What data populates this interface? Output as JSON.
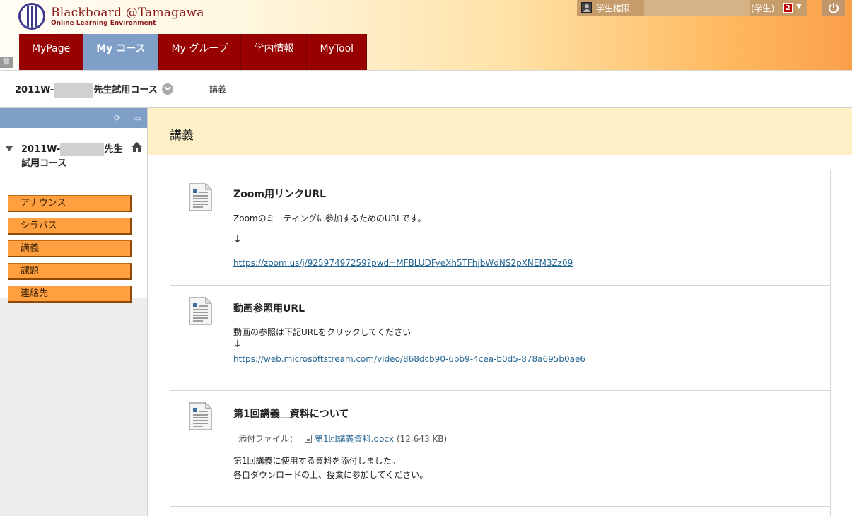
{
  "header": {
    "logo_title": "Blackboard @Tamagawa",
    "logo_subtitle": "Online Learning Environment",
    "user_name": "学生権限",
    "user_role": "(学生)",
    "notification_count": "2",
    "tabs": [
      {
        "label": "MyPage"
      },
      {
        "label": "My コース"
      },
      {
        "label": "My グループ"
      },
      {
        "label": "学内情報"
      },
      {
        "label": "MyTool"
      }
    ]
  },
  "breadcrumb": {
    "course_prefix": "2011W-",
    "course_suffix": "先生試用コース",
    "page": "講義"
  },
  "sidebar": {
    "course_prefix": "2011W-",
    "course_suffix": "先生試用コース",
    "items": [
      {
        "label": "アナウンス"
      },
      {
        "label": "シラバス"
      },
      {
        "label": "講義"
      },
      {
        "label": "課題"
      },
      {
        "label": "連絡先"
      }
    ]
  },
  "content": {
    "title": "講義",
    "items": [
      {
        "title": "Zoom用リンクURL",
        "text": "Zoomのミーティングに参加するためのURLです。",
        "arrow": "↓",
        "link": "https://zoom.us/j/92597497259?pwd=MFBLUDFyeXh5TFhjbWdNS2pXNEM3Zz09"
      },
      {
        "title": "動画参照用URL",
        "text": "動画の参照は下記URLをクリックしてください",
        "arrow": "↓",
        "link": "https://web.microsoftstream.com/video/868dcb90-6bb9-4cea-b0d5-878a695b0ae6"
      },
      {
        "title": "第1回講義＿資料について",
        "attach_label": "添付ファイル：",
        "attach_file": "第1回講義資料.docx",
        "attach_size": "(12.643 KB)",
        "text1": "第1回講義に使用する資料を添付しました。",
        "text2": "各自ダウンロードの上、授業に参加してください。"
      }
    ]
  },
  "colors": {
    "tab_red": "#990000",
    "tab_active": "#7f9fc9",
    "menu_orange": "#ff9f40",
    "content_header": "#fff1c7",
    "link_blue": "#246693"
  }
}
